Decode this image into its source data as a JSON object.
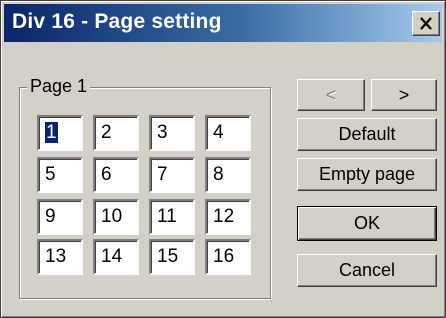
{
  "window": {
    "title": "Div 16 - Page setting",
    "close_label": "×"
  },
  "group": {
    "label": "Page 1",
    "cells": [
      "1",
      "2",
      "3",
      "4",
      "5",
      "6",
      "7",
      "8",
      "9",
      "10",
      "11",
      "12",
      "13",
      "14",
      "15",
      "16"
    ],
    "selected_cell": "1"
  },
  "buttons": {
    "prev": "<",
    "next": ">",
    "default": "Default",
    "empty_page": "Empty page",
    "ok": "OK",
    "cancel": "Cancel"
  },
  "colors": {
    "title_gradient_start": "#0a246a",
    "title_gradient_end": "#a6caf0",
    "dialog_face": "#d4d0c8",
    "selection": "#0a246a"
  },
  "icons": {
    "close": "close-icon"
  }
}
